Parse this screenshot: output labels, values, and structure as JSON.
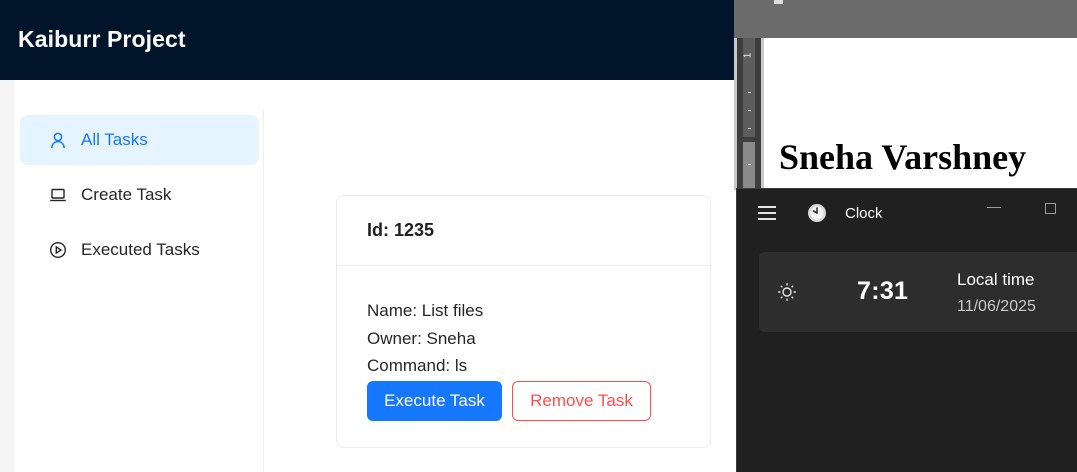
{
  "app": {
    "title": "Kaiburr Project",
    "menu": [
      {
        "label": "All Tasks",
        "icon": "user-icon",
        "selected": true
      },
      {
        "label": "Create Task",
        "icon": "laptop-icon",
        "selected": false
      },
      {
        "label": "Executed Tasks",
        "icon": "play-circle-icon",
        "selected": false
      }
    ],
    "task_card": {
      "id_line": "Id: 1235",
      "name_line": "Name: List files",
      "owner_line": "Owner: Sneha",
      "command_line": "Command: ls",
      "execute_label": "Execute Task",
      "remove_label": "Remove Task"
    },
    "colors": {
      "header": "#001529",
      "primary": "#1677ff",
      "danger": "#ff4d4f",
      "selected_bg": "#e6f4ff"
    }
  },
  "document": {
    "ruler_number": "1",
    "heading": "Sneha Varshney"
  },
  "clock_app": {
    "title": "Clock",
    "time": "7:31",
    "label": "Local time",
    "date": "11/06/2025"
  }
}
